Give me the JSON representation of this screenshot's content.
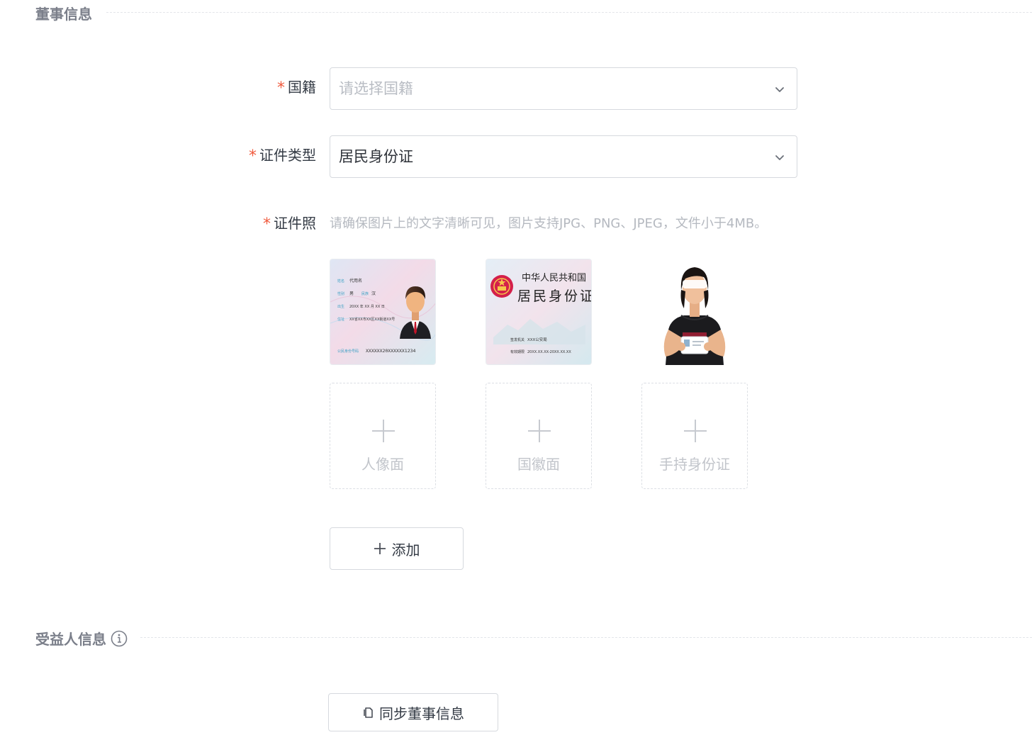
{
  "director_section": {
    "title": "董事信息"
  },
  "nationality": {
    "label": "国籍",
    "placeholder": "请选择国籍"
  },
  "id_type": {
    "label": "证件类型",
    "value": "居民身份证"
  },
  "id_photo": {
    "label": "证件照",
    "hint": "请确保图片上的文字清晰可见，图片支持JPG、PNG、JPEG，文件小于4MB。",
    "sample_front": {
      "name_label": "姓名",
      "name_value": "代用名",
      "sex_label": "性别",
      "sex_value": "男",
      "ethnicity_label": "民族",
      "ethnicity_value": "汉",
      "birth_label": "出生",
      "birth_value": "20XX 年 XX 月 XX 日",
      "address_label": "住址",
      "address_value": "XX省XX市XX区XX街道XX号",
      "id_label": "公民身份号码",
      "id_value": "XXXXXX20XXXXXX1234"
    },
    "sample_back": {
      "country": "中华人民共和国",
      "title": "居民身份证",
      "authority_label": "签发机关",
      "authority_value": "XXX公安局",
      "validity_label": "有效期限",
      "validity_value": "20XX.XX.XX-20XX.XX.XX"
    },
    "uploads": [
      {
        "label": "人像面"
      },
      {
        "label": "国徽面"
      },
      {
        "label": "手持身份证"
      }
    ]
  },
  "add_button": {
    "label": "添加"
  },
  "beneficiary_section": {
    "title": "受益人信息"
  },
  "sync_button": {
    "label": "同步董事信息"
  },
  "colors": {
    "required": "#f05a3d",
    "border": "#d6d9de",
    "section_title": "#7b7f8a"
  }
}
